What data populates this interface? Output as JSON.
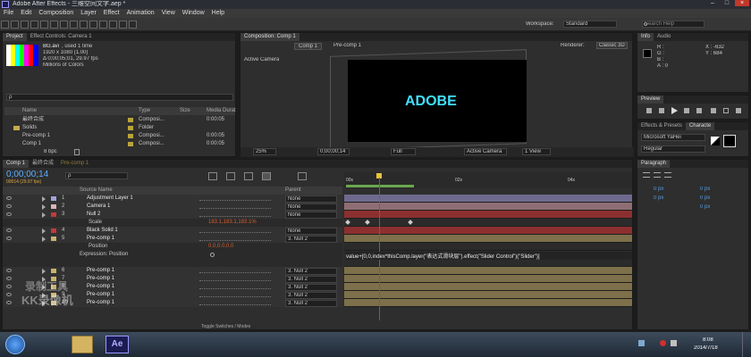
{
  "window": {
    "title": "Adobe After Effects - 三维空间文字.aep *",
    "controls": [
      "–",
      "□",
      "×"
    ]
  },
  "menu": [
    "File",
    "Edit",
    "Composition",
    "Layer",
    "Effect",
    "Animation",
    "View",
    "Window",
    "Help"
  ],
  "toolbar": {
    "workspace_label": "Workspace:",
    "workspace_value": "Standard",
    "search_placeholder": "Search Help"
  },
  "project": {
    "tabs": [
      "Project",
      "Effect Controls: Camera 1"
    ],
    "item_name": "BG.avi",
    "used": ", used 1 time",
    "size": "1920 x 1080 (1.00)",
    "duration": "Δ 0;00;05;01, 29.97 fps",
    "colors": "Millions of Colors",
    "search_placeholder": "ρ",
    "headers": [
      "Name",
      "Type",
      "Size",
      "Media Durat"
    ],
    "items": [
      {
        "name": "最终合成",
        "type": "Composi...",
        "dur": "0:00:05",
        "color": "#b8a43a"
      },
      {
        "name": "Solids",
        "type": "Folder",
        "dur": "",
        "color": "#b8a43a"
      },
      {
        "name": "Pre-comp 1",
        "type": "Composi...",
        "dur": "0:00:05",
        "color": "#b8a43a"
      },
      {
        "name": "Comp 1",
        "type": "Composi...",
        "dur": "0:00:05",
        "color": "#b8a43a"
      }
    ],
    "bpc": "8 bpc"
  },
  "composition": {
    "tab": "Composition: Comp 1",
    "crumbs": [
      "Comp 1",
      "Pre-comp 1"
    ],
    "renderer_label": "Renderer:",
    "renderer": "Classic 3D",
    "view_label": "Active Camera",
    "render_text": "ADOBE",
    "zoom": "25%",
    "timecode": "0;00;00;14",
    "res": "Full",
    "camera": "Active Camera",
    "views": "1 View"
  },
  "info": {
    "tabs": [
      "Info",
      "Audio"
    ],
    "r": "R :",
    "g": "G :",
    "b": "B :",
    "a": "A : 0",
    "x": "X : -632",
    "y": "Y : 684"
  },
  "preview": {
    "title": "Preview"
  },
  "effects": {
    "tabs": [
      "Effects & Presets",
      "Characte"
    ],
    "font": "Microsoft YaHei",
    "style": "Regular"
  },
  "paragraph": {
    "title": "Paragraph",
    "v1": "0 px",
    "v2": "0 px",
    "v3": "0 px",
    "v4": "0 px",
    "v5": "0 px"
  },
  "timeline": {
    "tabs": [
      "Comp 1",
      "最终合成",
      "Pre-comp 1"
    ],
    "timecode": "0;00;00;14",
    "frames": "00014 (29.97 fps)",
    "search_placeholder": "ρ",
    "col_source": "Source Name",
    "col_parent": "Parent",
    "ruler": [
      "00s",
      "02s",
      "04s"
    ],
    "layers": [
      {
        "num": "1",
        "name": "Adjustment Layer 1",
        "parent": "None",
        "color": "#a3a3d9",
        "bar": "#6e6a8e"
      },
      {
        "num": "2",
        "name": "Camera 1",
        "parent": "None",
        "color": "#d9b5b5",
        "bar": "#8e6e74"
      },
      {
        "num": "3",
        "name": "Null 2",
        "parent": "None",
        "color": "#c23a3a",
        "bar": "#8c2f2f"
      },
      {
        "num": "",
        "name": "Scale",
        "parent": "",
        "color": "",
        "bar": "#2b2b2b",
        "value": "183.1,183.1,183.1%"
      },
      {
        "num": "4",
        "name": "Black Solid 1",
        "parent": "None",
        "color": "#c23a3a",
        "bar": "#8c2f2f"
      },
      {
        "num": "5",
        "name": "Pre-comp 1",
        "parent": "3. Null 2",
        "color": "#c8b36f",
        "bar": "#7d704a"
      },
      {
        "num": "",
        "name": "Position",
        "parent": "",
        "color": "",
        "bar": "#2b2b2b",
        "value": "0.0,0.0,0.0"
      },
      {
        "num": "",
        "name": "Expression: Position",
        "parent": "",
        "color": "",
        "bar": "#2b2b2b"
      },
      {
        "num": "6",
        "name": "Pre-comp 1",
        "parent": "3. Null 2",
        "color": "#c8b36f",
        "bar": "#7d704a"
      },
      {
        "num": "7",
        "name": "Pre-comp 1",
        "parent": "3. Null 2",
        "color": "#c8b36f",
        "bar": "#7d704a"
      },
      {
        "num": "8",
        "name": "Pre-comp 1",
        "parent": "3. Null 2",
        "color": "#c8b36f",
        "bar": "#7d704a"
      },
      {
        "num": "9",
        "name": "Pre-comp 1",
        "parent": "3. Null 2",
        "color": "#c8b36f",
        "bar": "#7d704a"
      },
      {
        "num": "10",
        "name": "Pre-comp 1",
        "parent": "3. Null 2",
        "color": "#c8b36f",
        "bar": "#7d704a"
      }
    ],
    "expression": "value+[0,0,index*thisComp.layer(\"表达式滑块层\").effect(\"Slider Control\")(\"Slider\")]",
    "toggle": "Toggle Switches / Modes"
  },
  "watermark": {
    "line1": "录制工具",
    "line2": "KK录像机"
  },
  "taskbar": {
    "time": "8:08",
    "date": "2014/7/18",
    "ae_label": "Ae"
  }
}
